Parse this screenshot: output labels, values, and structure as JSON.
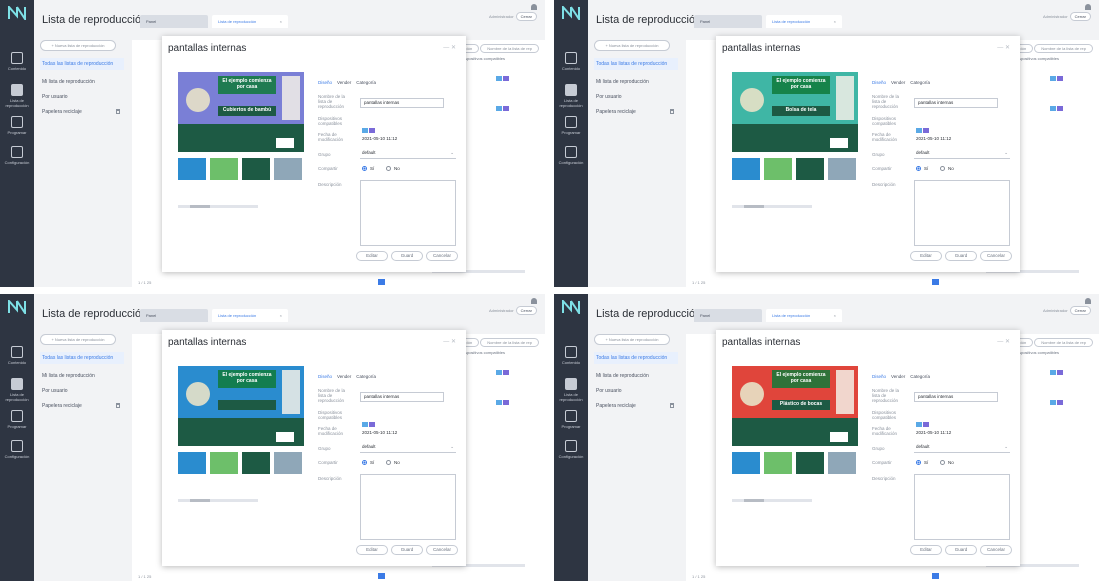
{
  "rail": {
    "items": [
      {
        "label": "Contenido"
      },
      {
        "label": "Lista de reproducción"
      },
      {
        "label": "Programar"
      },
      {
        "label": "Configuración"
      }
    ]
  },
  "app": {
    "title": "Lista de reproducción",
    "tabs": [
      {
        "label": "Panel"
      },
      {
        "label": "Lista de reproducción"
      }
    ],
    "user_label": "Administrador",
    "user_pill": "Cerrar"
  },
  "sidebar": {
    "new_button": "+ Nueva lista de reproducción",
    "items": [
      {
        "label": "Todas las listas de reproducción"
      },
      {
        "label": "Mi lista de reproducción"
      },
      {
        "label": "Por usuario"
      },
      {
        "label": "Papelera reciclaje"
      }
    ]
  },
  "table": {
    "filter_select": "Lista de reproducción",
    "filter_search": "Nombre de la lista de rep",
    "col_header": "Dispositivos compatibles"
  },
  "pager": {
    "text": "1 / 1",
    "page_size": "25"
  },
  "modal": {
    "title": "pantallas internas",
    "tabs": [
      "Diseño",
      "Vender",
      "Categoría"
    ],
    "fields": {
      "name_label": "Nombre de la lista de reproducción",
      "name_value": "pantallas internas",
      "devices_label": "Dispositivos compatibles",
      "date_label": "Fecha de modificación",
      "date_value": "2021-05-10 11:12",
      "group_label": "Grupo",
      "group_value": "default",
      "share_label": "Compartir",
      "share_yes": "Sí",
      "share_no": "No",
      "description_label": "Descripción"
    },
    "buttons": {
      "edit": "Editar",
      "save": "Guard",
      "cancel": "Cancelar"
    }
  },
  "previews": [
    {
      "headline": "El ejemplo comienza por casa",
      "sub": "Cubiertos de bambú",
      "bg": "#7a7fd6"
    },
    {
      "headline": "El ejemplo comienza por casa",
      "sub": "Bolsa de tela",
      "bg": "#3fb6a5"
    },
    {
      "headline": "El ejemplo comienza por casa",
      "sub": "",
      "bg": "#2a8ccf"
    },
    {
      "headline": "El ejemplo comienza por casa",
      "sub": "Plástico de bocas",
      "bg": "#e0453b"
    }
  ],
  "colors": {
    "accent": "#3b7be6",
    "rail": "#2e3542",
    "dark_green": "#1d5a44"
  }
}
